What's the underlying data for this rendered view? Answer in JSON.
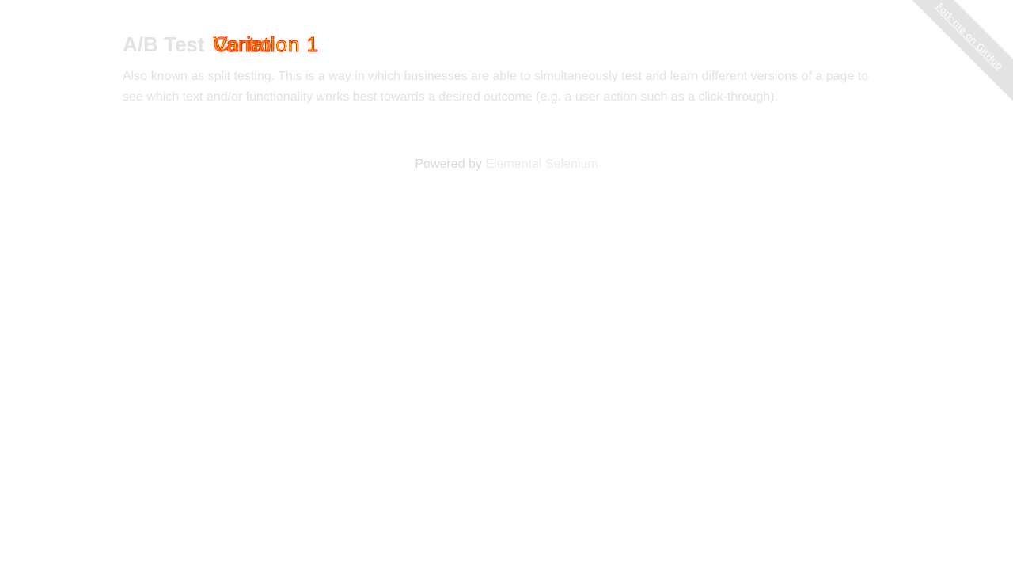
{
  "header": {
    "title": "A/B Test",
    "variant_primary": "Variation 1",
    "variant_overlay": "Control"
  },
  "main": {
    "description": "Also known as split testing. This is a way in which businesses are able to simultaneously test and learn different versions of a page to see which text and/or functionality works best towards a desired outcome (e.g. a user action such as a click-through)."
  },
  "footer": {
    "prefix": "Powered by",
    "link_label": "Elemental Selenium"
  },
  "ribbon": {
    "label": "Fork me on GitHub"
  },
  "colors": {
    "faded_text": "#e2e2e2",
    "variant_fill": "#ffe600",
    "variant_stroke": "#ff1a00",
    "ribbon_bg": "#e3e3e3"
  }
}
